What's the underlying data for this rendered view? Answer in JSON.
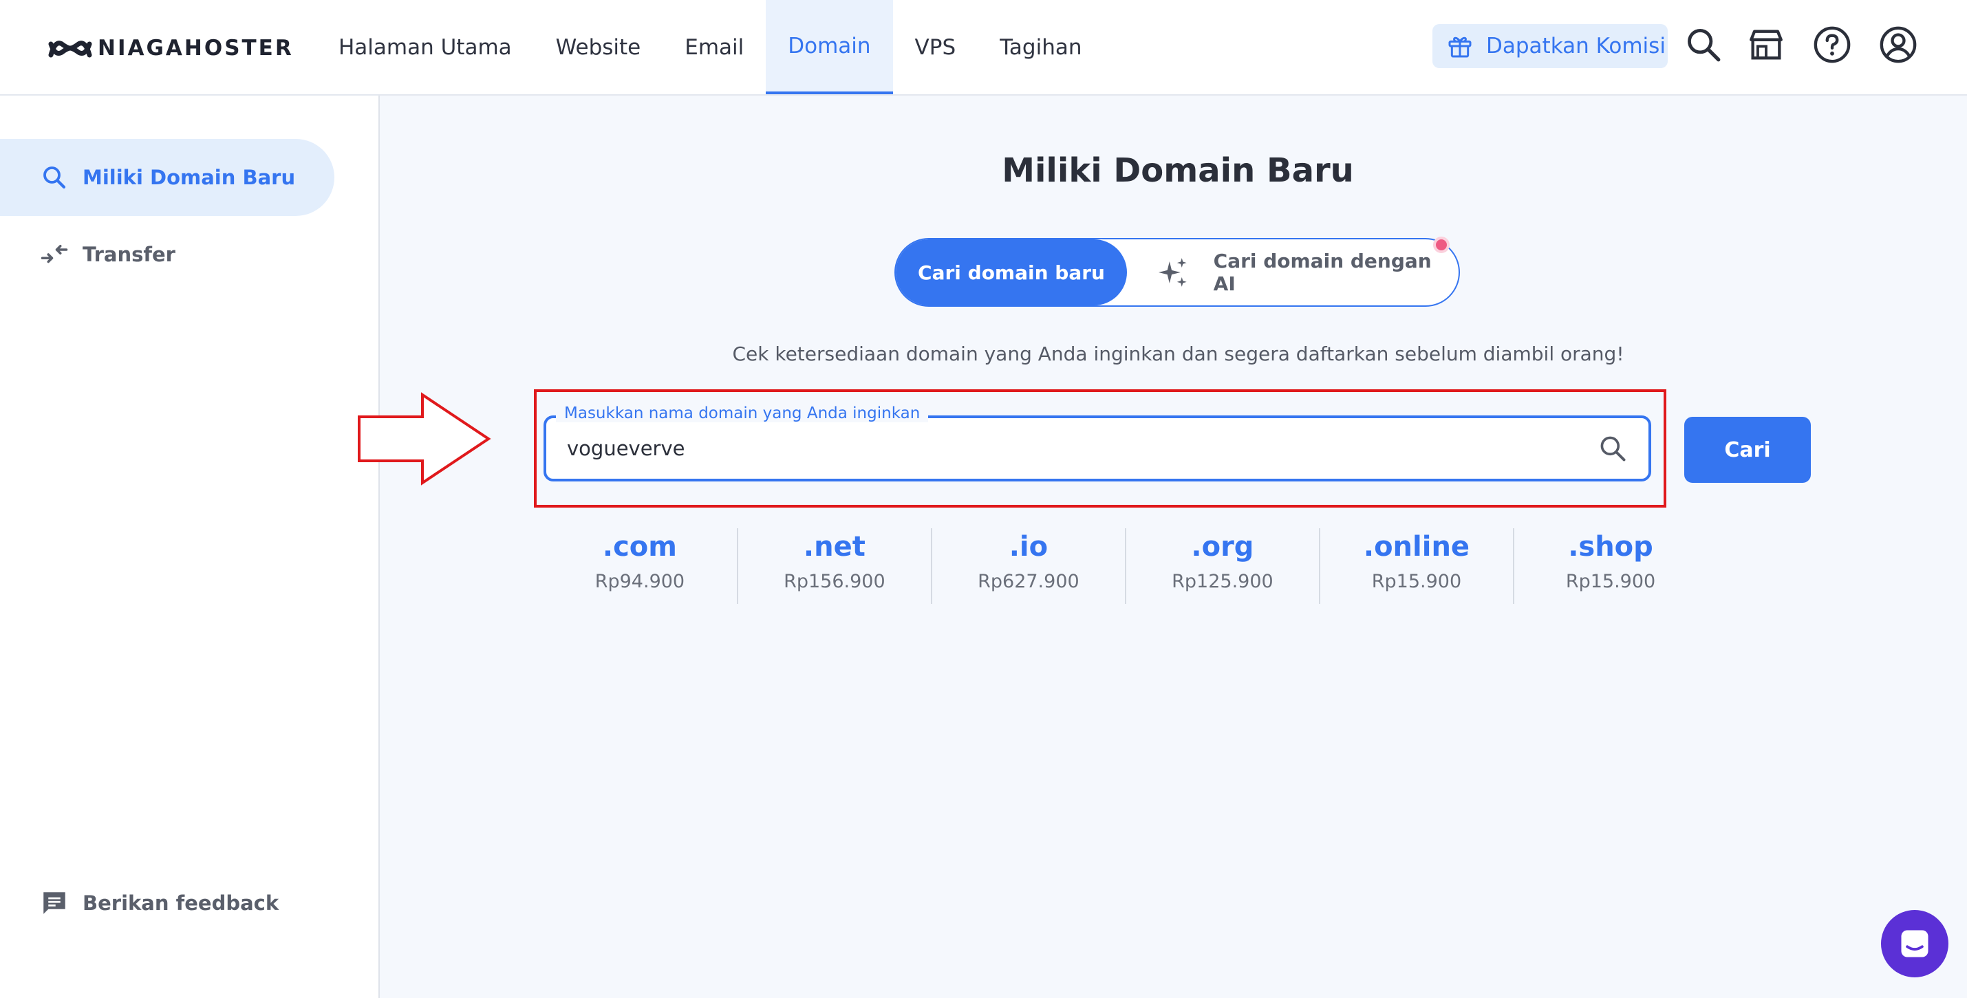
{
  "brand": {
    "name": "NIAGAHOSTER"
  },
  "nav": {
    "items": [
      {
        "label": "Halaman Utama"
      },
      {
        "label": "Website"
      },
      {
        "label": "Email"
      },
      {
        "label": "Domain",
        "active": true
      },
      {
        "label": "VPS"
      },
      {
        "label": "Tagihan"
      }
    ]
  },
  "header_actions": {
    "komisi_label": "Dapatkan Komisi",
    "icons": [
      "search-icon",
      "store-icon",
      "help-icon",
      "account-icon"
    ]
  },
  "sidebar": {
    "items": [
      {
        "label": "Miliki Domain Baru",
        "icon": "search-icon",
        "active": true
      },
      {
        "label": "Transfer",
        "icon": "transfer-icon"
      }
    ],
    "feedback_label": "Berikan feedback"
  },
  "main": {
    "title": "Miliki Domain Baru",
    "toggle": {
      "active_label": "Cari domain baru",
      "ai_label": "Cari domain dengan AI"
    },
    "subtitle": "Cek ketersediaan domain yang Anda inginkan dan segera daftarkan sebelum diambil orang!",
    "search": {
      "label": "Masukkan nama domain yang Anda inginkan",
      "value": "vogueverve",
      "button_label": "Cari"
    },
    "tlds": [
      {
        "name": ".com",
        "price": "Rp94.900"
      },
      {
        "name": ".net",
        "price": "Rp156.900"
      },
      {
        "name": ".io",
        "price": "Rp627.900"
      },
      {
        "name": ".org",
        "price": "Rp125.900"
      },
      {
        "name": ".online",
        "price": "Rp15.900"
      },
      {
        "name": ".shop",
        "price": "Rp15.900"
      }
    ]
  },
  "colors": {
    "accent": "#3575f0",
    "highlight": "#e0191c",
    "chat": "#5b30d6"
  }
}
